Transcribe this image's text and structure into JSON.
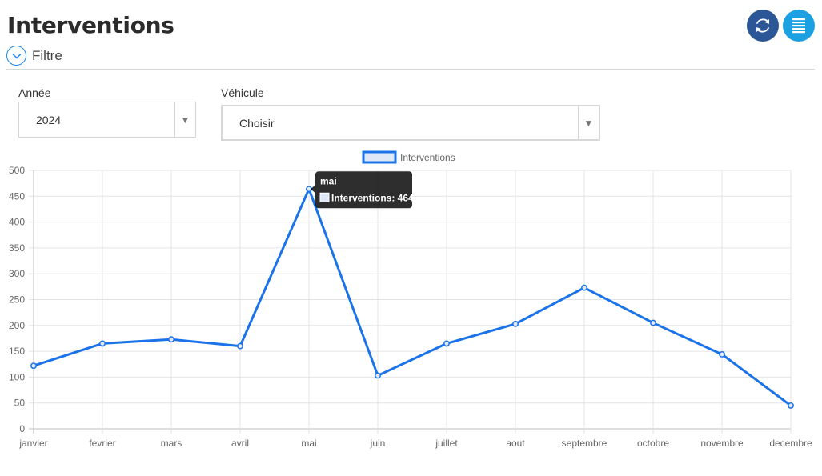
{
  "header": {
    "title": "Interventions"
  },
  "toolbar": {
    "refresh_icon": "refresh-icon",
    "list_icon": "list-icon"
  },
  "filter": {
    "label": "Filtre"
  },
  "fields": {
    "year": {
      "label": "Année",
      "value": "2024"
    },
    "vehicle": {
      "label": "Véhicule",
      "value": "Choisir"
    }
  },
  "colors": {
    "line": "#1a73e8",
    "refresh_btn": "#2b5797",
    "list_btn": "#1ba1e2"
  },
  "chart_data": {
    "type": "line",
    "categories": [
      "janvier",
      "fevrier",
      "mars",
      "avril",
      "mai",
      "juin",
      "juillet",
      "aout",
      "septembre",
      "octobre",
      "novembre",
      "decembre"
    ],
    "series": [
      {
        "name": "Interventions",
        "values": [
          122,
          165,
          173,
          160,
          464,
          103,
          165,
          203,
          273,
          205,
          144,
          45
        ]
      }
    ],
    "ylim": [
      0,
      500
    ],
    "yticks": [
      0,
      50,
      100,
      150,
      200,
      250,
      300,
      350,
      400,
      450,
      500
    ],
    "grid": true,
    "legend": "top-center",
    "tooltip": {
      "title": "mai",
      "label": "Interventions: 464"
    }
  }
}
